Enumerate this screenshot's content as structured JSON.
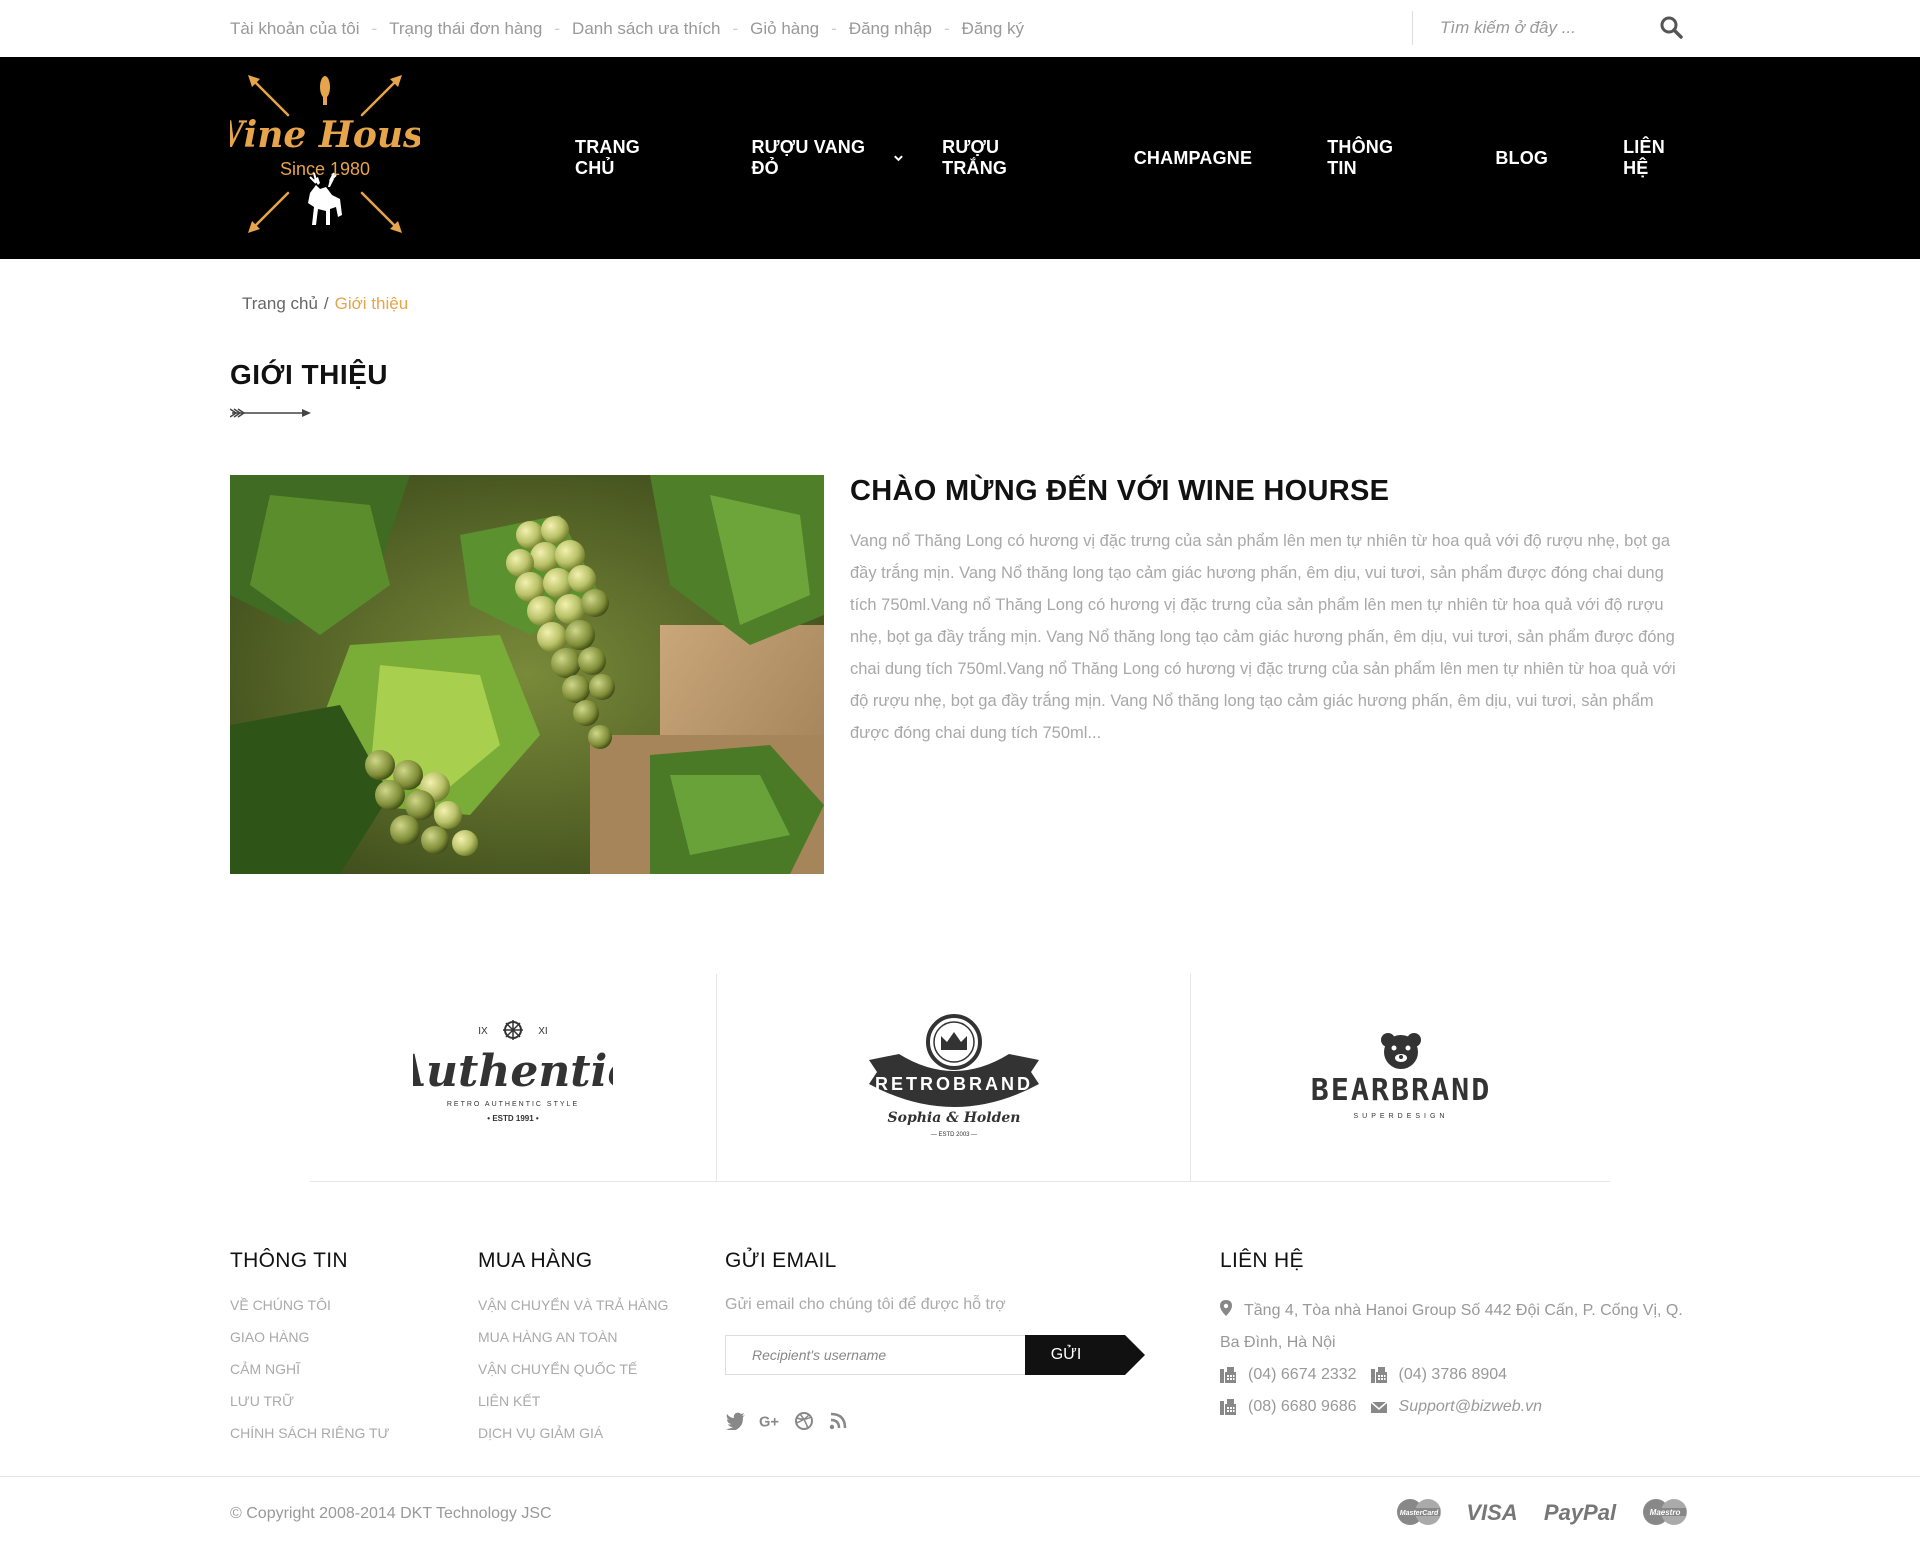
{
  "topbar": {
    "links": [
      "Tài khoản của tôi",
      "Trạng thái đơn hàng",
      "Danh sách ưa thích",
      "Giỏ hàng",
      "Đăng nhập",
      "Đăng ký"
    ],
    "search_placeholder": "Tìm kiếm ở đây ..."
  },
  "logo": {
    "line1": "Wine House",
    "line2": "Since 1980"
  },
  "nav": {
    "items": [
      "TRANG CHỦ",
      "RƯỢU VANG ĐỎ",
      "RƯỢU TRẮNG",
      "CHAMPAGNE",
      "THÔNG TIN",
      "BLOG",
      "LIÊN HỆ"
    ]
  },
  "breadcrumb": {
    "home": "Trang chủ",
    "separator": "/",
    "current": "Giới thiệu"
  },
  "page_title": "GIỚI THIỆU",
  "welcome": {
    "title": "CHÀO MỪNG ĐẾN VỚI WINE HOURSE",
    "text": "Vang nổ Thăng Long có hương vị đặc trưng của sản phẩm lên men tự nhiên từ hoa quả với độ rượu nhẹ, bọt ga đầy trắng mịn. Vang Nổ thăng long tạo cảm giác hương phấn, êm dịu, vui tươi, sản phẩm được đóng chai dung tích 750ml.Vang nổ Thăng Long có hương vị đặc trưng của sản phẩm lên men tự nhiên từ hoa quả với độ rượu nhẹ, bọt ga đầy trắng mịn. Vang Nổ thăng long tạo cảm giác hương phấn, êm dịu, vui tươi, sản phẩm được đóng chai dung tích 750ml.Vang nổ Thăng Long có hương vị đặc trưng của sản phẩm lên men tự nhiên từ hoa quả với độ rượu nhẹ, bọt ga đầy trắng mịn. Vang Nổ thăng long tạo cảm giác hương phấn, êm dịu, vui tươi, sản phẩm được đóng chai dung tích 750ml..."
  },
  "brands": {
    "authentic": {
      "top": "IX",
      "top2": "XI",
      "name": "Authentic",
      "sub": "RETRO AUTHENTIC STYLE",
      "estd": "• ESTD 1991 •"
    },
    "retro": {
      "name": "RETROBRAND",
      "sub": "Sophia & Holden",
      "estd": "— ESTD 2003 —"
    },
    "bear": {
      "name": "BEARBRAND",
      "sub": "SUPERDESIGN"
    }
  },
  "footer": {
    "info": {
      "title": "THÔNG TIN",
      "items": [
        "VỀ CHÚNG TÔI",
        "GIAO HÀNG",
        "CẢM NGHĨ",
        "LƯU TRỮ",
        "CHÍNH SÁCH RIÊNG TƯ"
      ]
    },
    "shop": {
      "title": "MUA HÀNG",
      "items": [
        "VẬN CHUYỂN VÀ TRẢ HÀNG",
        "MUA HÀNG AN TOÀN",
        "VẬN CHUYỂN QUỐC TẾ",
        "LIÊN KẾT",
        "DỊCH VỤ GIẢM GIÁ"
      ]
    },
    "email": {
      "title": "GỬI EMAIL",
      "desc": "Gửi email cho chúng tôi để được hỗ trợ",
      "placeholder": "Recipient's username",
      "button": "GỬI"
    },
    "contact": {
      "title": "LIÊN HỆ",
      "address": "Tầng 4, Tòa nhà Hanoi Group Số 442 Đội Cấn, P. Cống Vị, Q. Ba Đình, Hà Nội",
      "phone1": "(04) 6674 2332",
      "phone2": "(04) 3786 8904",
      "phone3": "(08) 6680 9686",
      "email": "Support@bizweb.vn"
    }
  },
  "copyright": "© Copyright 2008-2014 DKT Technology JSC",
  "payments": [
    "MasterCard",
    "VISA",
    "PayPal",
    "Maestro"
  ],
  "colors": {
    "accent": "#e6a44b",
    "header_bg": "#000000",
    "text_muted": "#999999"
  }
}
